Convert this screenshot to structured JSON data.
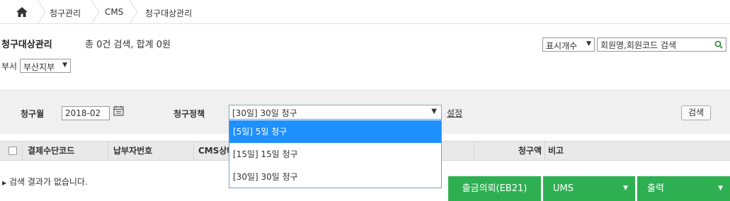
{
  "breadcrumb": {
    "items": [
      "청구관리",
      "CMS",
      "청구대상관리"
    ]
  },
  "header": {
    "title": "청구대상관리",
    "summary": "총 0건 검색, 합계 0원",
    "display_count_label": "표시개수",
    "search_value": "회원명,회원코드 검색"
  },
  "dept": {
    "label": "부서",
    "selected": "부산지부"
  },
  "filter": {
    "month_label": "청구월",
    "month_value": "2018-02",
    "policy_label": "청구정책",
    "policy_selected": "[30일] 30일 청구",
    "setting_label": "설정",
    "search_button": "검색"
  },
  "policy_options": [
    "[5일] 5일 청구",
    "[15일] 15일 청구",
    "[30일] 30일 청구"
  ],
  "table": {
    "columns": [
      "결제수단코드",
      "납부자번호",
      "CMS상태",
      "청구액",
      "비고"
    ]
  },
  "empty_message": "검색 결과가 없습니다.",
  "actions": {
    "withdraw": "출금의뢰(EB21)",
    "ums": "UMS",
    "print": "출력"
  },
  "colors": {
    "action_green": "#2eb052",
    "dropdown_highlight": "#1e90ff"
  }
}
